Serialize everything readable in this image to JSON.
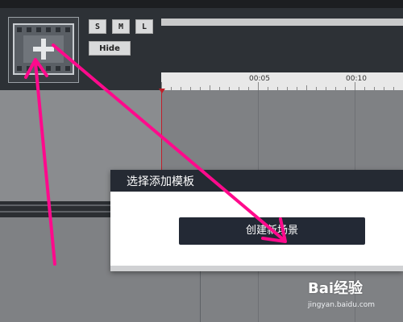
{
  "toolbar": {
    "add_scene_icon": "film-plus-icon",
    "size_buttons": [
      "S",
      "M",
      "L"
    ],
    "hide_label": "Hide"
  },
  "timeline": {
    "ruler_labels": [
      "00:05",
      "00:10"
    ],
    "playhead_color": "#c0202a"
  },
  "dialog": {
    "title": "选择添加模板",
    "create_button_label": "创建新场景"
  },
  "annotations": {
    "arrow_color": "#ff0a8c"
  },
  "watermark": {
    "brand": "Bai经验",
    "url": "jingyan.baidu.com"
  }
}
